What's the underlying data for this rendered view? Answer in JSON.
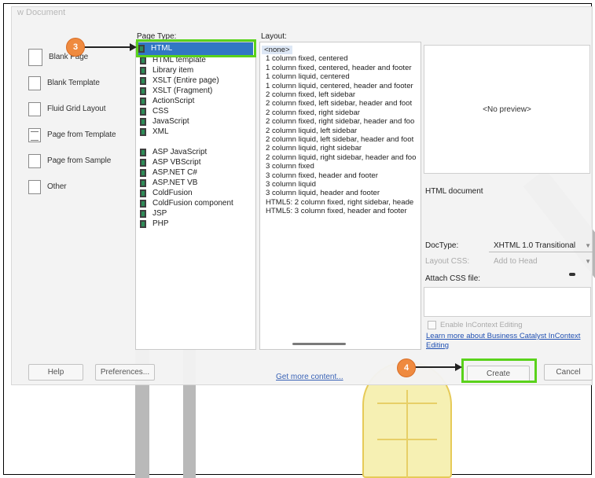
{
  "dialog": {
    "title": "w Document"
  },
  "categories": {
    "items": [
      {
        "label": "Blank Page",
        "icon": "page-icon",
        "selected": true
      },
      {
        "label": "Blank Template",
        "icon": "template-icon"
      },
      {
        "label": "Fluid Grid Layout",
        "icon": "fluid-grid-icon"
      },
      {
        "label": "Page from Template",
        "icon": "page-from-template-icon"
      },
      {
        "label": "Page from Sample",
        "icon": "page-from-sample-icon"
      },
      {
        "label": "Other",
        "icon": "other-icon"
      }
    ]
  },
  "page_type": {
    "title": "Page Type:",
    "items": [
      "HTML",
      "HTML template",
      "Library item",
      "XSLT (Entire page)",
      "XSLT (Fragment)",
      "ActionScript",
      "CSS",
      "JavaScript",
      "XML",
      "ASP JavaScript",
      "ASP VBScript",
      "ASP.NET C#",
      "ASP.NET VB",
      "ColdFusion",
      "ColdFusion component",
      "JSP",
      "PHP"
    ],
    "selected": "HTML"
  },
  "layout": {
    "title": "Layout:",
    "items": [
      "<none>",
      "1 column fixed, centered",
      "1 column fixed, centered, header and footer",
      "1 column liquid, centered",
      "1 column liquid, centered, header and footer",
      "2 column fixed, left sidebar",
      "2 column fixed, left sidebar, header and foot",
      "2 column fixed, right sidebar",
      "2 column fixed, right sidebar, header and foo",
      "2 column liquid, left sidebar",
      "2 column liquid, left sidebar, header and foot",
      "2 column liquid, right sidebar",
      "2 column liquid, right sidebar, header and foo",
      "3 column fixed",
      "3 column fixed, header and footer",
      "3 column liquid",
      "3 column liquid, header and footer",
      "HTML5: 2 column fixed, right sidebar, heade",
      "HTML5: 3 column fixed, header and footer"
    ],
    "selected": "<none>"
  },
  "preview": {
    "text": "<No preview>",
    "description": "HTML document"
  },
  "doctype": {
    "label": "DocType:",
    "value": "XHTML 1.0 Transitional"
  },
  "layout_css": {
    "label": "Layout CSS:",
    "value": "Add to Head"
  },
  "attach_css": {
    "label": "Attach CSS file:"
  },
  "incontext": {
    "label": "Enable InContext Editing",
    "checked": false
  },
  "learn_more": {
    "text": "Learn more about Business Catalyst InContext Editing"
  },
  "buttons": {
    "help": "Help",
    "preferences": "Preferences...",
    "get_more": "Get more content...",
    "create": "Create",
    "cancel": "Cancel"
  },
  "annotations": {
    "step3": "3",
    "step4": "4",
    "highlight_color": "#5ad21b",
    "badge_color": "#ef8a3f"
  }
}
